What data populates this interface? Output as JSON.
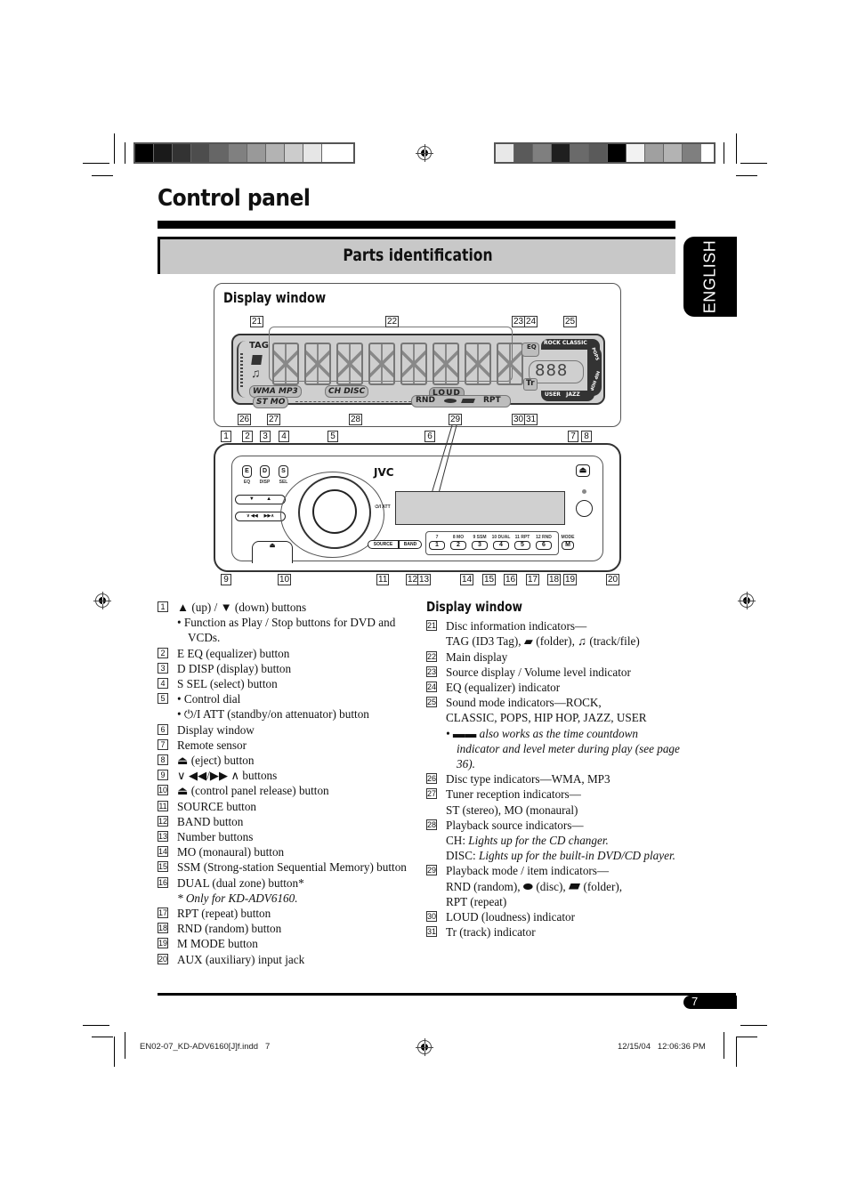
{
  "page": {
    "title": "Control panel",
    "section": "Parts identification",
    "language_tab": "ENGLISH",
    "page_number": "7",
    "footer_left": "EN02-07_KD-ADV6160[J]f.indd   7",
    "footer_right": "12/15/04   12:06:36 PM"
  },
  "color_bars": {
    "left": [
      "#000000",
      "#1a1a1a",
      "#333333",
      "#4d4d4d",
      "#666666",
      "#808080",
      "#999999",
      "#b3b3b3",
      "#cccccc",
      "#e6e6e6",
      "#ffffff"
    ],
    "right": [
      "#e8e8e8",
      "#5a5a5a",
      "#7f7f7f",
      "#1f1f1f",
      "#6a6a6a",
      "#5a5a5a",
      "#000000",
      "#f2f2f2",
      "#a0a0a0",
      "#b3b3b3",
      "#7f7f7f"
    ]
  },
  "display_diagram": {
    "heading": "Display window",
    "callouts_top": [
      "21",
      "22",
      "23",
      "24",
      "25"
    ],
    "callouts_bottom": [
      "26",
      "27",
      "28",
      "29",
      "30",
      "31"
    ],
    "lcd": {
      "tag": "TAG",
      "disc_types": "WMA  MP3",
      "sources": "CH  DISC",
      "tuner": "ST MO",
      "loud": "LOUD",
      "rnd": "RND",
      "rpt": "RPT",
      "eq": "EQ",
      "tr": "Tr",
      "sound_modes_top": "ROCK  CLASSIC",
      "pops": "POPS",
      "hiphop": "HIP HOP",
      "sound_modes_bottom": "USER   JAZZ",
      "volume_digits": "888"
    }
  },
  "panel_diagram": {
    "callouts_top": [
      "1",
      "2",
      "3",
      "4",
      "5",
      "6",
      "7",
      "8"
    ],
    "callouts_bottom": [
      "9",
      "10",
      "11",
      "12",
      "13",
      "14",
      "15",
      "16",
      "17",
      "18",
      "19",
      "20"
    ],
    "brand": "JVC",
    "buttons": {
      "e": "E",
      "e_sub": "EQ",
      "d": "D",
      "d_sub": "DISP",
      "s": "S",
      "s_sub": "SEL",
      "updown": "▼        ▲",
      "skip": "∨ ◀◀     ▶▶∧",
      "release": "⏏",
      "source": "SOURCE",
      "band": "BAND",
      "att": "⏻/I ATT",
      "mode": "M",
      "mode_sub": "MODE",
      "eject": "⏏"
    },
    "number_buttons": [
      {
        "label": "1",
        "sub": "7"
      },
      {
        "label": "2",
        "sub": "8 MO"
      },
      {
        "label": "3",
        "sub": "9 SSM"
      },
      {
        "label": "4",
        "sub": "10 DUAL"
      },
      {
        "label": "5",
        "sub": "11 RPT"
      },
      {
        "label": "6",
        "sub": "12 RND"
      }
    ]
  },
  "left_list": [
    {
      "n": "1",
      "text": "▲ (up) / ▼ (down) buttons",
      "subs": [
        "Function as Play / Stop buttons for DVD and VCDs."
      ]
    },
    {
      "n": "2",
      "text": "E EQ (equalizer) button"
    },
    {
      "n": "3",
      "text": "D DISP (display) button"
    },
    {
      "n": "4",
      "text": "S SEL (select) button"
    },
    {
      "n": "5",
      "text": "• Control dial",
      "subs": [
        "⏻/I ATT (standby/on attenuator) button"
      ]
    },
    {
      "n": "6",
      "text": "Display window"
    },
    {
      "n": "7",
      "text": "Remote sensor"
    },
    {
      "n": "8",
      "text": "⏏ (eject) button"
    },
    {
      "n": "9",
      "text": "∨ ◀◀/▶▶ ∧ buttons"
    },
    {
      "n": "10",
      "text": "⏏ (control panel release) button"
    },
    {
      "n": "11",
      "text": "SOURCE button"
    },
    {
      "n": "12",
      "text": "BAND button"
    },
    {
      "n": "13",
      "text": "Number buttons"
    },
    {
      "n": "14",
      "text": "MO (monaural) button"
    },
    {
      "n": "15",
      "text": "SSM (Strong-station Sequential Memory) button"
    },
    {
      "n": "16",
      "text": "DUAL (dual zone) button*",
      "note": "* Only for KD-ADV6160."
    },
    {
      "n": "17",
      "text": "RPT (repeat) button"
    },
    {
      "n": "18",
      "text": "RND (random) button"
    },
    {
      "n": "19",
      "text": "M MODE button"
    },
    {
      "n": "20",
      "text": "AUX (auxiliary) input jack"
    }
  ],
  "right_list": {
    "heading": "Display window",
    "items": [
      {
        "n": "21",
        "text": "Disc information indicators—",
        "line2": "TAG (ID3 Tag), ▰ (folder), ♫ (track/file)"
      },
      {
        "n": "22",
        "text": "Main display"
      },
      {
        "n": "23",
        "text": "Source display / Volume level indicator"
      },
      {
        "n": "24",
        "text": "EQ (equalizer) indicator"
      },
      {
        "n": "25",
        "text": "Sound mode indicators—ROCK,",
        "line2": "CLASSIC, POPS, HIP HOP, JAZZ, USER",
        "sub_italic": "▬▬ also works as the time countdown indicator and level meter during play (see page 36)."
      },
      {
        "n": "26",
        "text": "Disc type indicators—WMA, MP3"
      },
      {
        "n": "27",
        "text": "Tuner reception indicators—",
        "line2": "ST (stereo), MO (monaural)"
      },
      {
        "n": "28",
        "text": "Playback source indicators—",
        "ch_label": "CH:",
        "ch_desc": "Lights up for the CD changer.",
        "disc_label": "DISC:",
        "disc_desc": "Lights up for the built-in DVD/CD player."
      },
      {
        "n": "29",
        "text": "Playback mode / item indicators—",
        "line2": "RND (random), ⬬ (disc), ▰ (folder),",
        "line3": "RPT (repeat)"
      },
      {
        "n": "30",
        "text": "LOUD (loudness) indicator"
      },
      {
        "n": "31",
        "text": "Tr (track) indicator"
      }
    ]
  }
}
